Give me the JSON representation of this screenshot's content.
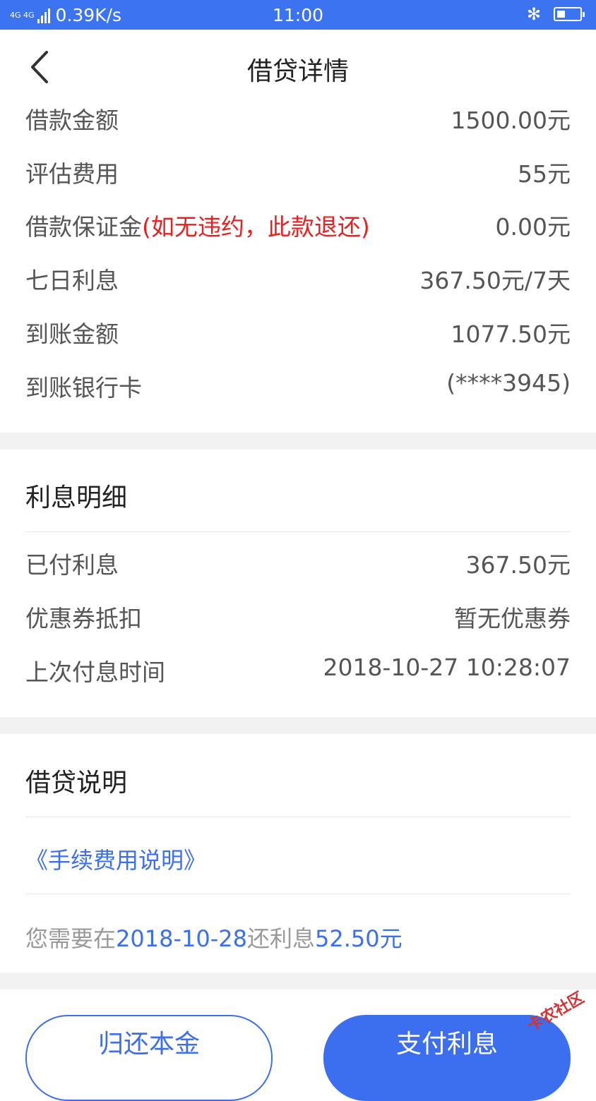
{
  "status_bar": {
    "network": "4G 4G",
    "speed": "0.39K/s",
    "time": "11:00"
  },
  "nav": {
    "title": "借贷详情"
  },
  "loan_details": [
    {
      "label": "借款金额",
      "value": "1500.00元"
    },
    {
      "label": "评估费用",
      "value": "55元"
    },
    {
      "label": "借款保证金",
      "note": "(如无违约，此款退还)",
      "value": "0.00元"
    },
    {
      "label": "七日利息",
      "value": "367.50元/7天"
    },
    {
      "label": "到账金额",
      "value": "1077.50元"
    },
    {
      "label": "到账银行卡",
      "value": "(****3945)"
    }
  ],
  "interest": {
    "title": "利息明细",
    "rows": [
      {
        "label": "已付利息",
        "value": "367.50元"
      },
      {
        "label": "优惠券抵扣",
        "value": "暂无优惠券"
      },
      {
        "label": "上次付息时间",
        "value": "2018-10-27 10:28:07"
      }
    ]
  },
  "explanation": {
    "title": "借贷说明",
    "fee_link": "《手续费用说明》",
    "notice_prefix": "您需要在",
    "notice_date": "2018-10-28",
    "notice_middle": "还利息",
    "notice_amount": "52.50元"
  },
  "actions": {
    "return_principal": "归还本金",
    "pay_interest": "支付利息"
  },
  "watermark": "卡农社区",
  "colors": {
    "brand": "#3b6ff0",
    "warning": "#e8201f"
  }
}
